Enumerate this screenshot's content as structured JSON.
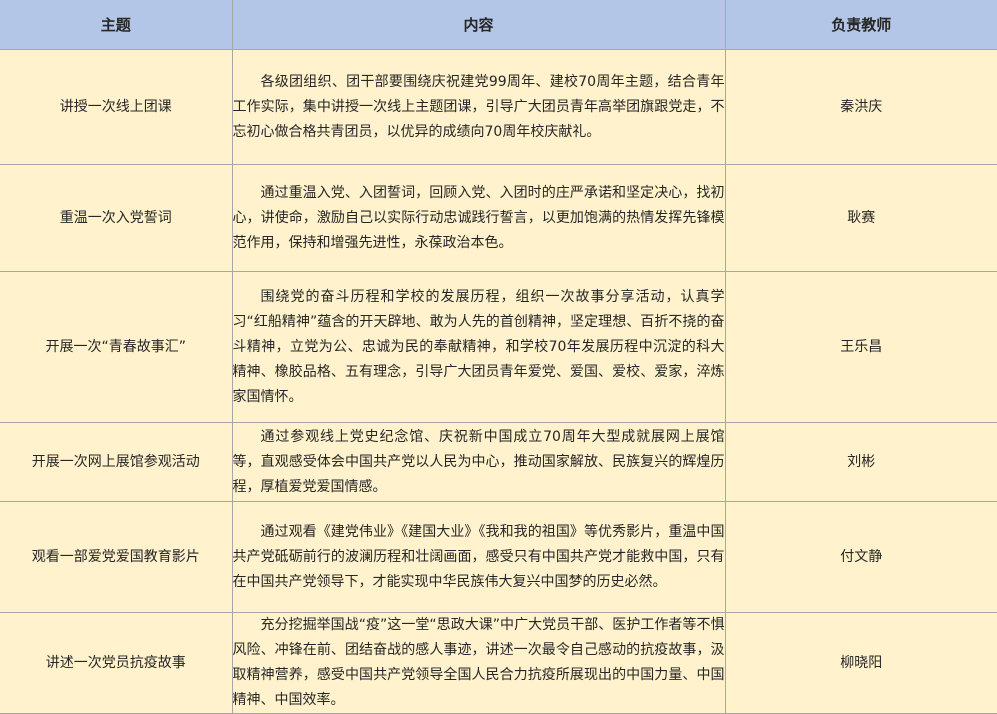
{
  "headers": {
    "topic": "主题",
    "content": "内容",
    "teacher": "负责教师"
  },
  "rows": [
    {
      "topic": "讲授一次线上团课",
      "content": "各级团组织、团干部要围绕庆祝建党99周年、建校70周年主题，结合青年工作实际，集中讲授一次线上主题团课，引导广大团员青年高举团旗跟党走，不忘初心做合格共青团员，以优异的成绩向70周年校庆献礼。",
      "teacher": "秦洪庆"
    },
    {
      "topic": "重温一次入党誓词",
      "content": "通过重温入党、入团誓词，回顾入党、入团时的庄严承诺和坚定决心，找初心，讲使命，激励自己以实际行动忠诚践行誓言，以更加饱满的热情发挥先锋模范作用，保持和增强先进性，永葆政治本色。",
      "teacher": "耿赛"
    },
    {
      "topic": "开展一次“青春故事汇”",
      "content": "围绕党的奋斗历程和学校的发展历程，组织一次故事分享活动，认真学习“红船精神”蕴含的开天辟地、敢为人先的首创精神，坚定理想、百折不挠的奋斗精神，立党为公、忠诚为民的奉献精神，和学校70年发展历程中沉淀的科大精神、橡胶品格、五有理念，引导广大团员青年爱党、爱国、爱校、爱家，淬炼家国情怀。",
      "teacher": "王乐昌"
    },
    {
      "topic": "开展一次网上展馆参观活动",
      "content": "通过参观线上党史纪念馆、庆祝新中国成立70周年大型成就展网上展馆等，直观感受体会中国共产党以人民为中心，推动国家解放、民族复兴的辉煌历程，厚植爱党爱国情感。",
      "teacher": "刘彬"
    },
    {
      "topic": "观看一部爱党爱国教育影片",
      "content": "通过观看《建党伟业》《建国大业》《我和我的祖国》等优秀影片，重温中国共产党砥砺前行的波澜历程和壮阔画面，感受只有中国共产党才能救中国，只有在中国共产党领导下，才能实现中华民族伟大复兴中国梦的历史必然。",
      "teacher": "付文静"
    },
    {
      "topic": "讲述一次党员抗疫故事",
      "content": "充分挖掘举国战“疫”这一堂“思政大课”中广大党员干部、医护工作者等不惧风险、冲锋在前、团结奋战的感人事迹，讲述一次最令自己感动的抗疫故事，汲取精神营养，感受中国共产党领导全国人民合力抗疫所展现出的中国力量、中国精神、中国效率。",
      "teacher": "柳晓阳"
    }
  ]
}
